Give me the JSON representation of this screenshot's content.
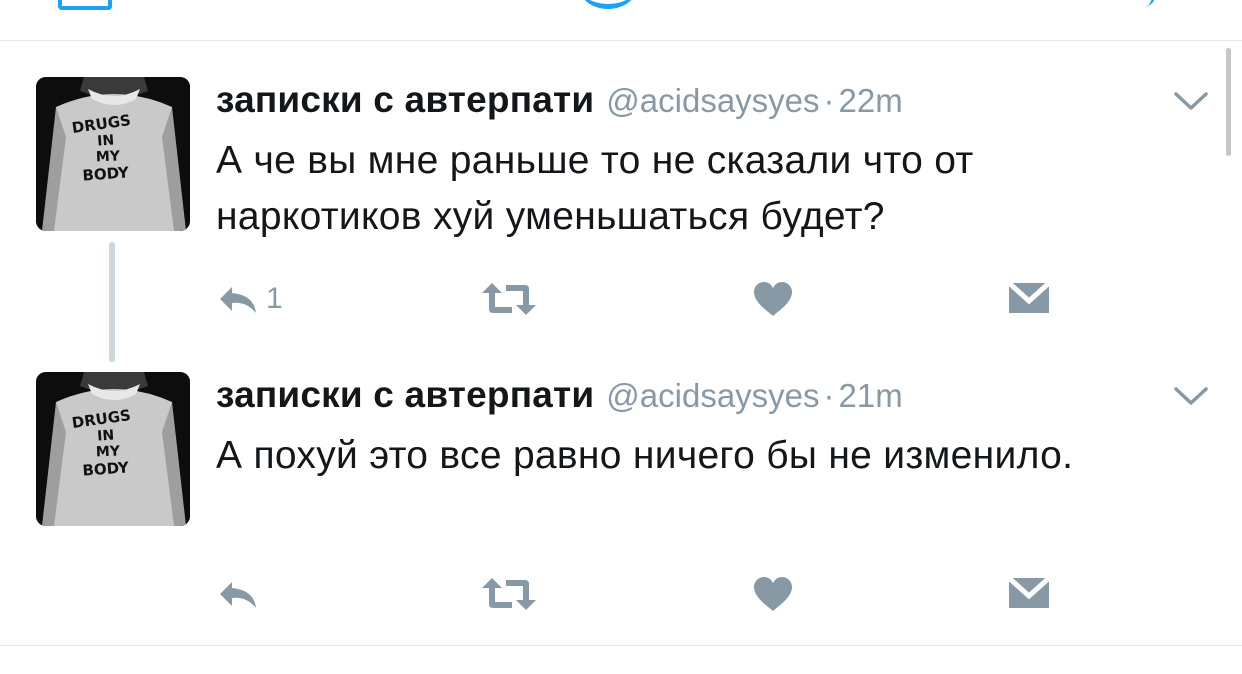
{
  "colors": {
    "accent": "#1da1f2",
    "icon_gray": "#8899a6",
    "text": "#14171a",
    "divider": "#e1e8ed",
    "thread_line": "#ccd6dd"
  },
  "avatar_shirt_text": [
    "DRUGS",
    "IN",
    "MY",
    "BODY"
  ],
  "tweets": [
    {
      "display_name": "записки с автерпати",
      "handle": "@acidsaysyes",
      "separator": "·",
      "time": "22m",
      "text": "А че вы мне раньше то не сказали что от наркотиков хуй уменьшаться будет?",
      "reply_count": "1",
      "icons": [
        "reply-icon",
        "retweet-icon",
        "like-icon",
        "direct-message-icon",
        "chevron-down-icon"
      ]
    },
    {
      "display_name": "записки с автерпати",
      "handle": "@acidsaysyes",
      "separator": "·",
      "time": "21m",
      "text": "А похуй это все равно ничего бы не изменило.",
      "reply_count": "",
      "icons": [
        "reply-icon",
        "retweet-icon",
        "like-icon",
        "direct-message-icon",
        "chevron-down-icon"
      ]
    }
  ]
}
